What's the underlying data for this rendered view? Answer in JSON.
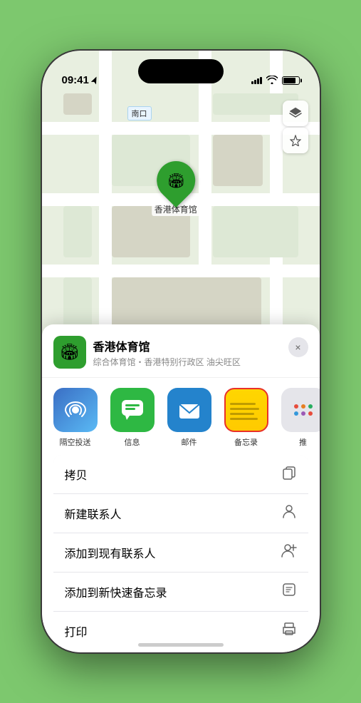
{
  "statusBar": {
    "time": "09:41",
    "timeIcon": "location-arrow-icon"
  },
  "map": {
    "label": "南口",
    "markerLabel": "香港体育馆"
  },
  "venue": {
    "name": "香港体育馆",
    "subtitle": "综合体育馆・香港特别行政区 油尖旺区",
    "icon": "🏟"
  },
  "shareApps": [
    {
      "label": "隔空投送",
      "type": "airdrop"
    },
    {
      "label": "信息",
      "type": "messages"
    },
    {
      "label": "邮件",
      "type": "mail"
    },
    {
      "label": "备忘录",
      "type": "notes"
    },
    {
      "label": "推",
      "type": "more"
    }
  ],
  "actions": [
    {
      "label": "拷贝",
      "icon": "copy"
    },
    {
      "label": "新建联系人",
      "icon": "person"
    },
    {
      "label": "添加到现有联系人",
      "icon": "person-add"
    },
    {
      "label": "添加到新快速备忘录",
      "icon": "note"
    },
    {
      "label": "打印",
      "icon": "printer"
    }
  ],
  "buttons": {
    "close": "×"
  }
}
